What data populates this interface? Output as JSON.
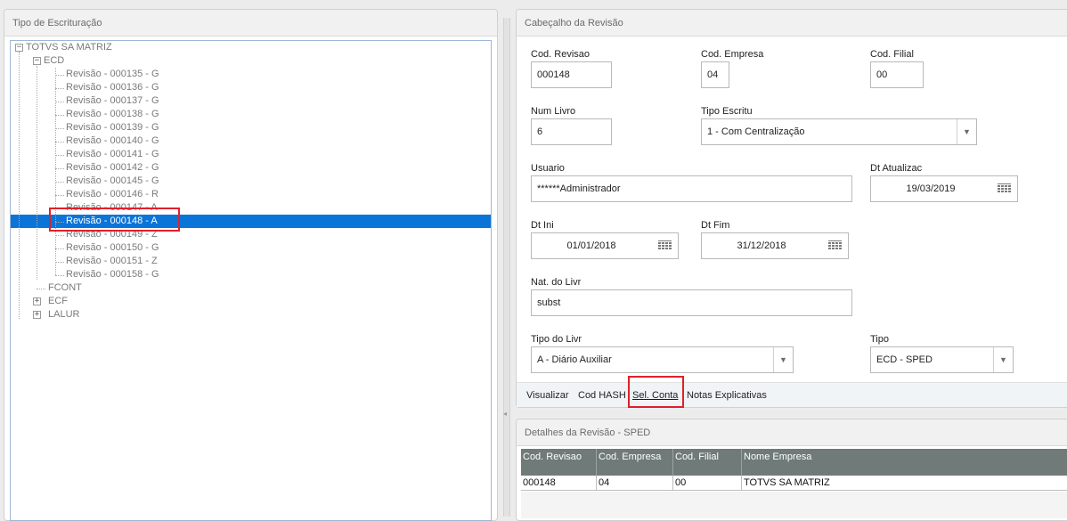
{
  "left_panel": {
    "title": "Tipo de Escrituração",
    "tree": {
      "root": "TOTVS SA MATRIZ",
      "nodes": [
        {
          "label": "ECD",
          "expanded": true,
          "children": [
            "Revisão - 000135 - G",
            "Revisão - 000136 - G",
            "Revisão - 000137 - G",
            "Revisão - 000138 - G",
            "Revisão - 000139 - G",
            "Revisão - 000140 - G",
            "Revisão - 000141 - G",
            "Revisão - 000142 - G",
            "Revisão - 000145 - G",
            "Revisão - 000146 - R",
            "Revisão - 000147 - A",
            "Revisão - 000148 - A",
            "Revisão - 000149 - Z",
            "Revisão - 000150 - G",
            "Revisão - 000151 - Z",
            "Revisão - 000158 - G"
          ],
          "selected": "Revisão - 000148 - A"
        },
        {
          "label": "FCONT",
          "expanded": false
        },
        {
          "label": "ECF",
          "expanded": false
        },
        {
          "label": "LALUR",
          "expanded": false
        }
      ]
    }
  },
  "header_panel": {
    "title": "Cabeçalho da Revisão",
    "fields": {
      "cod_revisao": {
        "label": "Cod. Revisao",
        "value": "000148"
      },
      "cod_empresa": {
        "label": "Cod. Empresa",
        "value": "04"
      },
      "cod_filial": {
        "label": "Cod. Filial",
        "value": "00"
      },
      "num_livro": {
        "label": "Num Livro",
        "value": "6"
      },
      "tipo_escritu": {
        "label": "Tipo Escritu",
        "value": "1 - Com Centralização"
      },
      "usuario": {
        "label": "Usuario",
        "value": "******Administrador"
      },
      "dt_atualizac": {
        "label": "Dt Atualizac",
        "value": "19/03/2019"
      },
      "dt_ini": {
        "label": "Dt Ini",
        "value": "01/01/2018"
      },
      "dt_fim": {
        "label": "Dt Fim",
        "value": "31/12/2018"
      },
      "nat_livr": {
        "label": "Nat. do Livr",
        "value": "subst"
      },
      "tipo_livr": {
        "label": "Tipo do Livr",
        "value": "A - Diário Auxiliar"
      },
      "tipo": {
        "label": "Tipo",
        "value": "ECD - SPED"
      }
    },
    "actions": {
      "visualizar": "Visualizar",
      "cod_hash": "Cod HASH",
      "sel_conta": "Sel. Conta",
      "notas": "Notas Explicativas"
    }
  },
  "details_panel": {
    "title": "Detalhes da Revisão - SPED",
    "columns": [
      "Cod. Revisao",
      "Cod. Empresa",
      "Cod. Filial",
      "Nome Empresa"
    ],
    "rows": [
      [
        "000148",
        "04",
        "00",
        "TOTVS SA MATRIZ"
      ]
    ]
  },
  "colors": {
    "selection": "#0b74d8",
    "highlight": "#e0202a",
    "grid_header": "#6f7a79"
  }
}
